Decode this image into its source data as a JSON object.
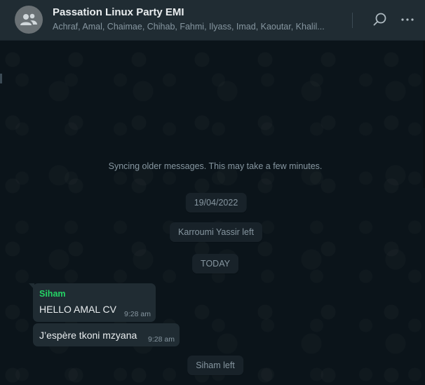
{
  "header": {
    "title": "Passation Linux Party EMI",
    "subtitle": "Achraf, Amal, Chaimae, Chihab, Fahmi, Ilyass, Imad, Kaoutar, Khalil..."
  },
  "icons": {
    "avatar": "group-icon",
    "search": "search-icon",
    "menu": "more-options-icon"
  },
  "colors": {
    "header_bg": "#202c33",
    "chat_bg": "#0b141a",
    "bubble_bg": "#202c33",
    "sender_name": "#25d366",
    "text_primary": "#e9edef",
    "text_secondary": "#8696a0"
  },
  "chat": {
    "sync_notice": "Syncing older messages. This may take a few minutes.",
    "date_label": "19/04/2022",
    "event_left_1": "Karroumi Yassir left",
    "today_label": "TODAY",
    "messages": [
      {
        "sender": "Siham",
        "text": "HELLO AMAL CV",
        "time": "9:28 am"
      },
      {
        "text": "J’espère tkoni mzyana",
        "time": "9:28 am"
      }
    ],
    "event_left_2": "Siham left"
  }
}
